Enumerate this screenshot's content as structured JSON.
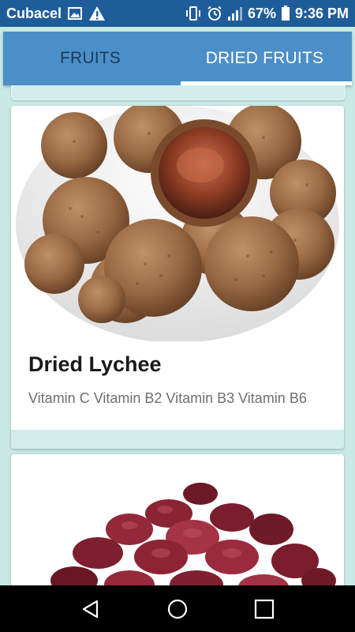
{
  "status_bar": {
    "carrier": "Cubacel",
    "battery": "67%",
    "time": "9:36 PM",
    "icons": [
      "image-icon",
      "warning-icon",
      "vibrate-icon",
      "alarm-icon",
      "signal-icon",
      "battery-icon"
    ]
  },
  "tabs": [
    {
      "label": "FRUITS",
      "active": false
    },
    {
      "label": "DRIED FRUITS",
      "active": true
    }
  ],
  "cards": [
    {
      "title": "Dried Lychee",
      "description": "Vitamin C Vitamin B2 Vitamin B3 Vitamin B6",
      "image": "dried-lychee-photo"
    },
    {
      "title": "",
      "description": "",
      "image": "dried-cranberries-photo"
    }
  ],
  "colors": {
    "status_bar": "#1f5d9a",
    "tab_bar": "#4b8fc8",
    "background": "#c9e9e5",
    "card_footer": "#d3eeea",
    "title_text": "#1a1a1a",
    "desc_text": "#6f6f6f"
  },
  "nav_bar": {
    "buttons": [
      "back-icon",
      "home-icon",
      "recents-icon"
    ]
  }
}
